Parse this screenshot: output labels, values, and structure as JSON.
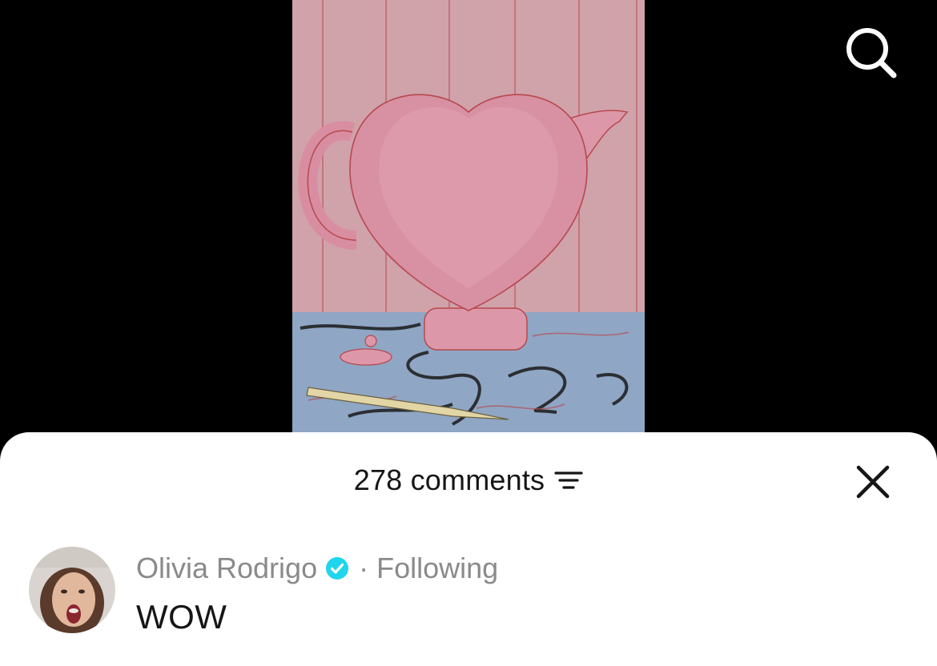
{
  "header": {
    "comments_label": "278 comments"
  },
  "comment": {
    "username": "Olivia Rodrigo",
    "separator": "·",
    "follow_status": "Following",
    "text": "WOW"
  },
  "icons": {
    "search": "search-icon",
    "filter": "sort-filter-icon",
    "close": "close-icon",
    "verified": "verified-badge-icon"
  },
  "colors": {
    "verified": "#20d5ec",
    "muted_text": "#8a8a8a",
    "primary_text": "#161616"
  }
}
